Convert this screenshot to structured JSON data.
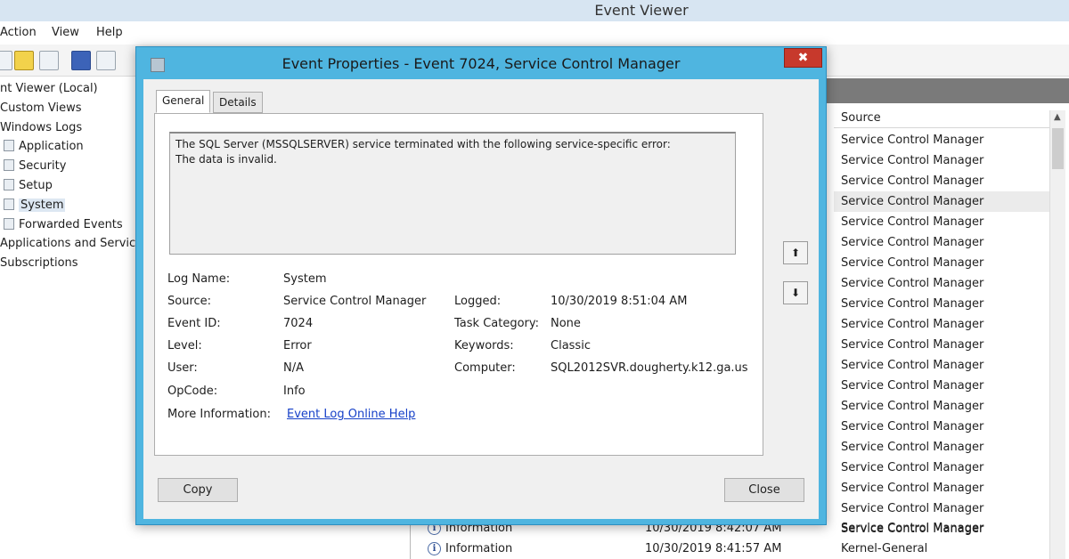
{
  "background_window": {
    "title": "Event Viewer",
    "menu": [
      "Action",
      "View",
      "Help"
    ],
    "tree": [
      {
        "label": "nt Viewer (Local)",
        "icon": false
      },
      {
        "label": "Custom Views",
        "icon": false
      },
      {
        "label": "Windows Logs",
        "icon": false
      },
      {
        "label": "Application",
        "icon": true
      },
      {
        "label": "Security",
        "icon": true
      },
      {
        "label": "Setup",
        "icon": true
      },
      {
        "label": "System",
        "icon": true,
        "selected": true
      },
      {
        "label": "Forwarded Events",
        "icon": true
      },
      {
        "label": "Applications and Services",
        "icon": false
      },
      {
        "label": "Subscriptions",
        "icon": false
      }
    ],
    "source_column_header": "Source",
    "source_rows": [
      "Service Control Manager",
      "Service Control Manager",
      "Service Control Manager",
      "Service Control Manager",
      "Service Control Manager",
      "Service Control Manager",
      "Service Control Manager",
      "Service Control Manager",
      "Service Control Manager",
      "Service Control Manager",
      "Service Control Manager",
      "Service Control Manager",
      "Service Control Manager",
      "Service Control Manager",
      "Service Control Manager",
      "Service Control Manager",
      "Service Control Manager",
      "Service Control Manager",
      "Service Control Manager",
      "Service Control Manager"
    ],
    "bottom_rows": [
      {
        "level": "Information",
        "date": "10/30/2019 8:42:07 AM",
        "source": "Service Control Manager"
      },
      {
        "level": "Information",
        "date": "10/30/2019 8:41:57 AM",
        "source": "Kernel-General"
      }
    ]
  },
  "dialog": {
    "title": "Event Properties - Event 7024, Service Control Manager",
    "close_glyph": "✖",
    "tabs": [
      "General",
      "Details"
    ],
    "description_line1": "The SQL Server (MSSQLSERVER) service terminated with the following service-specific error:",
    "description_line2": "The data is invalid.",
    "fields_left": [
      {
        "label": "Log Name:",
        "value": "System"
      },
      {
        "label": "Source:",
        "value": "Service Control Manager"
      },
      {
        "label": "Event ID:",
        "value": "7024"
      },
      {
        "label": "Level:",
        "value": "Error"
      },
      {
        "label": "User:",
        "value": "N/A"
      },
      {
        "label": "OpCode:",
        "value": "Info"
      }
    ],
    "fields_right": [
      {
        "label": "Logged:",
        "value": "10/30/2019 8:51:04 AM"
      },
      {
        "label": "Task Category:",
        "value": "None"
      },
      {
        "label": "Keywords:",
        "value": "Classic"
      },
      {
        "label": "Computer:",
        "value": "SQL2012SVR.dougherty.k12.ga.us"
      }
    ],
    "more_info_label": "More Information:",
    "more_info_link": "Event Log Online Help",
    "nav_up_glyph": "⬆",
    "nav_down_glyph": "⬇",
    "copy_label": "Copy",
    "close_label": "Close"
  }
}
